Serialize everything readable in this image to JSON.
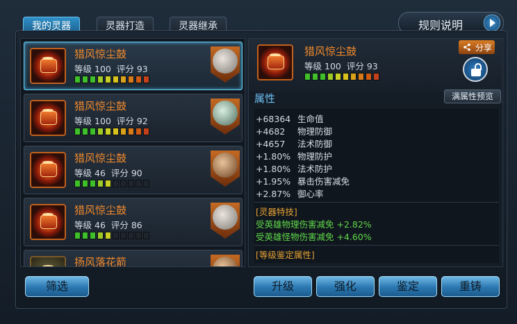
{
  "tabs": [
    "我的灵器",
    "灵器打造",
    "灵器继承"
  ],
  "rules_button": "规则说明",
  "list": {
    "items": [
      {
        "name": "猎风惊尘鼓",
        "level_label": "等级",
        "level": "100",
        "score_label": "评分",
        "score": "93",
        "filled": 10,
        "badge": "portrait-grey"
      },
      {
        "name": "猎风惊尘鼓",
        "level_label": "等级",
        "level": "100",
        "score_label": "评分",
        "score": "92",
        "filled": 10,
        "badge": "portrait-green"
      },
      {
        "name": "猎风惊尘鼓",
        "level_label": "等级",
        "level": "46",
        "score_label": "评分",
        "score": "90",
        "filled": 5,
        "badge": "portrait-brown"
      },
      {
        "name": "猎风惊尘鼓",
        "level_label": "等级",
        "level": "46",
        "score_label": "评分",
        "score": "86",
        "filled": 5,
        "badge": "portrait-grey"
      },
      {
        "name": "扬风落花箭"
      }
    ]
  },
  "detail": {
    "name": "猎风惊尘鼓",
    "level_label": "等级",
    "level": "100",
    "score_label": "评分",
    "score": "93",
    "filled": 10,
    "share": "分享",
    "section_attr": "属性",
    "preview": "满属性预览",
    "attrs": [
      {
        "value": "+68364",
        "label": "生命值"
      },
      {
        "value": "+4682",
        "label": "物理防御"
      },
      {
        "value": "+4657",
        "label": "法术防御"
      },
      {
        "value": "+1.80%",
        "label": "物理防护"
      },
      {
        "value": "+1.80%",
        "label": "法术防护"
      },
      {
        "value": "+1.95%",
        "label": "暴击伤害减免"
      },
      {
        "value": "+2.87%",
        "label": "御心率"
      }
    ],
    "skill_title": "[灵器特技]",
    "skills": [
      "受英雄物理伤害减免 +2.82%",
      "受英雄怪物伤害减免 +4.60%"
    ],
    "identify_title": "[等级鉴定属性]"
  },
  "buttons": {
    "filter": "筛选",
    "upgrade": "升级",
    "enhance": "强化",
    "identify": "鉴定",
    "recast": "重铸"
  },
  "colors": {
    "accent": "#2f90c8",
    "name": "#f28a2c",
    "attr_title": "#6ec0f2",
    "skill_text": "#5fd84a",
    "bar_colors": [
      "#3fbf2a",
      "#3fbf2a",
      "#3fbf2a",
      "#9ecb26",
      "#c9cf24",
      "#d9c21e",
      "#d9a21a",
      "#d77a17",
      "#cf5a14",
      "#c2401a"
    ]
  }
}
